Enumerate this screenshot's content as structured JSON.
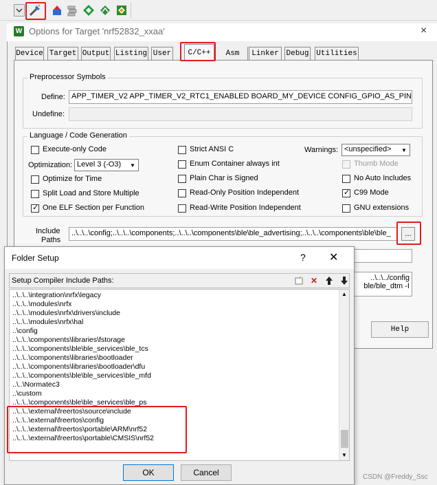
{
  "toolbar": {
    "icons": [
      "dropdown-arrow",
      "magic-wand-options",
      "load-download",
      "stack",
      "diamond-green",
      "bug-debug",
      "flash-download"
    ]
  },
  "dialog": {
    "title": "Options for Target 'nrf52832_xxaa'",
    "app_icon": "W",
    "close": "×",
    "tabs": [
      "Device",
      "Target",
      "Output",
      "Listing",
      "User",
      "C/C++",
      "Asm",
      "Linker",
      "Debug",
      "Utilities"
    ],
    "active_tab": "C/C++",
    "preprocessor": {
      "title": "Preprocessor Symbols",
      "define_label": "Define:",
      "define_value": "APP_TIMER_V2 APP_TIMER_V2_RTC1_ENABLED BOARD_MY_DEVICE CONFIG_GPIO_AS_PINRESET",
      "undefine_label": "Undefine:",
      "undefine_value": ""
    },
    "language": {
      "title": "Language / Code Generation",
      "execute_only": "Execute-only Code",
      "optimization_label": "Optimization:",
      "optimization_value": "Level 3 (-O3)",
      "optimize_time": "Optimize for Time",
      "split_load": "Split Load and Store Multiple",
      "one_elf": "One ELF Section per Function",
      "strict_ansi": "Strict ANSI C",
      "enum_container": "Enum Container always int",
      "plain_char": "Plain Char is Signed",
      "ro_pi": "Read-Only Position Independent",
      "rw_pi": "Read-Write Position Independent",
      "warnings_label": "Warnings:",
      "warnings_value": "<unspecified>",
      "thumb_mode": "Thumb Mode",
      "no_auto": "No Auto Includes",
      "c99": "C99 Mode",
      "gnu_ext": "GNU extensions"
    },
    "include_label_1": "Include",
    "include_label_2": "Paths",
    "include_value": "..\\..\\..\\config;..\\..\\..\\components;..\\..\\..\\components\\ble\\ble_advertising;..\\..\\..\\components\\ble\\ble_",
    "browse_btn": "...",
    "misc_line_1": "..\\..\\../config",
    "misc_line_2": "ble/ble_dtm -I",
    "help": "Help"
  },
  "folder_setup": {
    "title": "Folder Setup",
    "help": "?",
    "close": "✕",
    "header": "Setup Compiler Include Paths:",
    "paths": [
      "..\\..\\..\\integration\\nrfx\\legacy",
      "..\\..\\..\\modules\\nrfx",
      "..\\..\\..\\modules\\nrfx\\drivers\\include",
      "..\\..\\..\\modules\\nrfx\\hal",
      "..\\config",
      "..\\..\\..\\components\\libraries\\fstorage",
      "..\\..\\..\\components\\ble\\ble_services\\ble_tcs",
      "..\\..\\..\\components\\libraries\\bootloader",
      "..\\..\\..\\components\\libraries\\bootloader\\dfu",
      "..\\..\\..\\components\\ble\\ble_services\\ble_mfd",
      "..\\..\\Normatec3",
      "..\\custom",
      "..\\..\\..\\components\\ble\\ble_services\\ble_ps",
      "..\\..\\..\\external\\freertos\\source\\include",
      "..\\..\\..\\external\\freertos\\config",
      "..\\..\\..\\external\\freertos\\portable\\ARM\\nrf52",
      "..\\..\\..\\external\\freertos\\portable\\CMSIS\\nrf52"
    ],
    "ok": "OK",
    "cancel": "Cancel"
  },
  "watermark": "CSDN @Freddy_Ssc",
  "colors": {
    "highlight": "#e21b1b",
    "accent": "#0078d7"
  }
}
